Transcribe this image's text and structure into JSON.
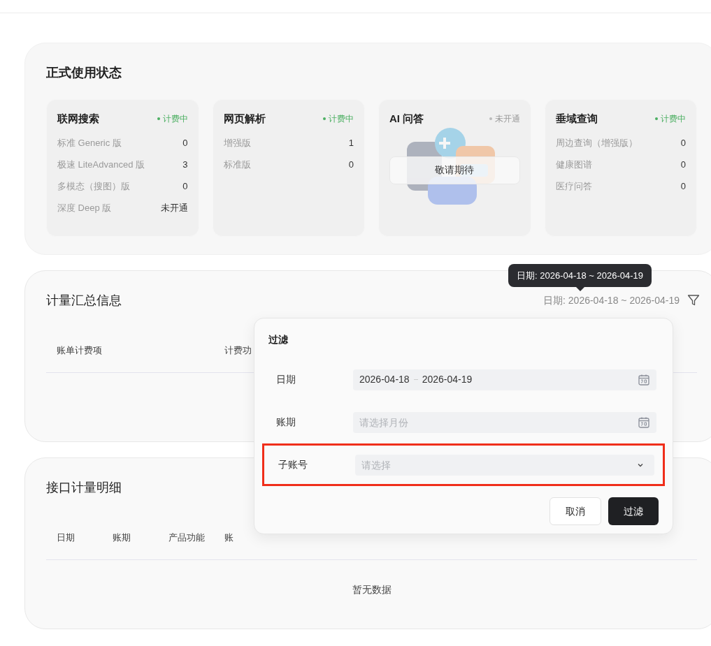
{
  "usage_status": {
    "title": "正式使用状态",
    "cards": [
      {
        "kind": "stats",
        "title": "联网搜索",
        "status": {
          "text": "计费中",
          "active": true
        },
        "rows": [
          {
            "label": "标准 Generic 版",
            "value": "0"
          },
          {
            "label": "极速 LiteAdvanced 版",
            "value": "3"
          },
          {
            "label": "多模态（搜图）版",
            "value": "0"
          },
          {
            "label": "深度 Deep 版",
            "value": "未开通"
          }
        ]
      },
      {
        "kind": "stats",
        "title": "网页解析",
        "status": {
          "text": "计费中",
          "active": true
        },
        "rows": [
          {
            "label": "增强版",
            "value": "1"
          },
          {
            "label": "标准版",
            "value": "0"
          }
        ]
      },
      {
        "kind": "coming_soon",
        "title": "AI 问答",
        "status": {
          "text": "未开通",
          "active": false
        },
        "button": "敬请期待"
      },
      {
        "kind": "stats",
        "title": "垂域查询",
        "status": {
          "text": "计费中",
          "active": true
        },
        "rows": [
          {
            "label": "周边查询（增强版）",
            "value": "0"
          },
          {
            "label": "健康图谱",
            "value": "0"
          },
          {
            "label": "医疗问答",
            "value": "0"
          }
        ]
      }
    ]
  },
  "summary": {
    "title": "计量汇总信息",
    "date_filter": "日期: 2026-04-18 ~ 2026-04-19",
    "tooltip": "日期: 2026-04-18 ~ 2026-04-19",
    "columns": [
      "账单计费项",
      "计费功"
    ]
  },
  "filter_popover": {
    "title": "过滤",
    "fields": [
      {
        "kind": "date_range",
        "label": "日期",
        "start": "2026-04-18",
        "end": "2026-04-19",
        "highlighted": false
      },
      {
        "kind": "month",
        "label": "账期",
        "placeholder": "请选择月份",
        "highlighted": false
      },
      {
        "kind": "select",
        "label": "子账号",
        "placeholder": "请选择",
        "highlighted": true
      }
    ],
    "buttons": [
      {
        "label": "取消",
        "primary": false
      },
      {
        "label": "过滤",
        "primary": true
      }
    ]
  },
  "details": {
    "title": "接口计量明细",
    "columns": [
      "日期",
      "账期",
      "产品功能",
      "账"
    ],
    "empty_text": "暂无数据"
  }
}
